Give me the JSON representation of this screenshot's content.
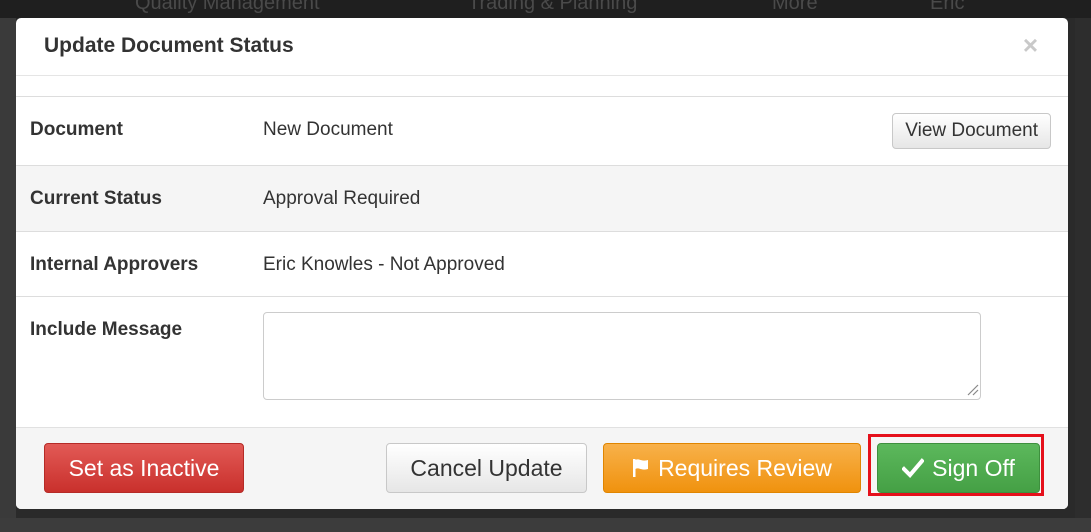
{
  "backdrop": {
    "nav_items": [
      "Quality Management",
      "Trading & Planning",
      "More",
      "Eric"
    ]
  },
  "modal": {
    "title": "Update Document Status",
    "close_glyph": "×"
  },
  "rows": {
    "document": {
      "label": "Document",
      "value": "New Document",
      "button": "View Document"
    },
    "status": {
      "label": "Current Status",
      "value": "Approval Required"
    },
    "approvers": {
      "label": "Internal Approvers",
      "value": "Eric Knowles - Not Approved"
    },
    "message": {
      "label": "Include Message",
      "value": "",
      "placeholder": ""
    }
  },
  "footer": {
    "inactive_label": "Set as Inactive",
    "cancel_label": "Cancel Update",
    "review_label": "Requires Review",
    "review_icon": "flag-icon",
    "signoff_label": "Sign Off",
    "signoff_icon": "check-icon"
  },
  "colors": {
    "danger": "#d9534f",
    "warning": "#f0ad4e",
    "success": "#5cb85c",
    "highlight": "#e5101b"
  }
}
